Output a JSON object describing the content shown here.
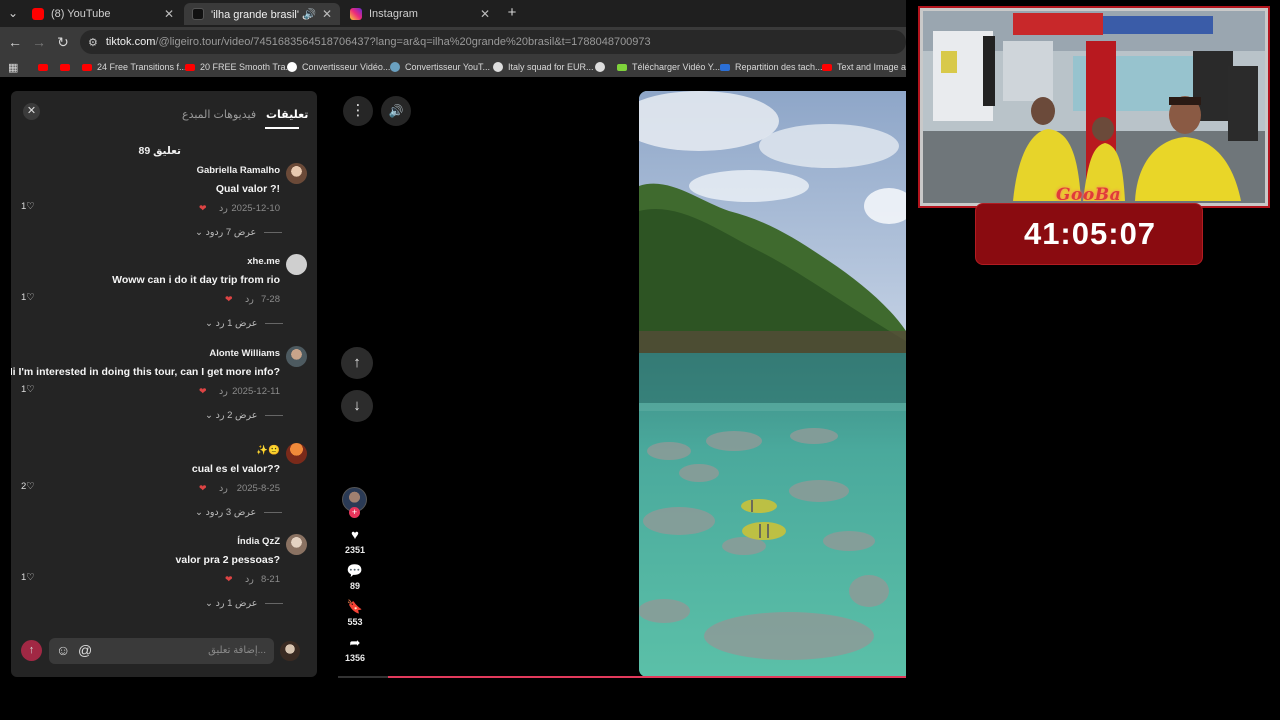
{
  "tabs": [
    {
      "title": "(8) YouTube",
      "color": "#ff0000"
    },
    {
      "title": "'ilha grande brasil' اعثر على",
      "color": "#111111",
      "active": true
    },
    {
      "title": "Instagram",
      "color": "#d62976"
    }
  ],
  "tab_close_glyph": "✕",
  "new_tab_glyph": "+",
  "tab_list_glyph": "⌄",
  "mute_glyph": "🔊",
  "url": {
    "host": "tiktok.com",
    "rest": "/@ligeiro.tour/video/7451683564518706437?lang=ar&q=ilha%20grande%20brasil&t=1788048700973"
  },
  "bookmarks": [
    {
      "label": "",
      "color": "#ff0000"
    },
    {
      "label": "",
      "color": "#ff0000"
    },
    {
      "label": "24 Free Transitions f...",
      "color": "#ff0000"
    },
    {
      "label": "20 FREE Smooth Tra...",
      "color": "#ff0000"
    },
    {
      "label": "Convertisseur Vidéo...",
      "color": "#ffffff",
      "round": true
    },
    {
      "label": "Convertisseur YouT...",
      "color": "#6aa0c0",
      "round": true
    },
    {
      "label": "Italy squad for EUR...",
      "color": "#dddddd",
      "round": true
    },
    {
      "label": "",
      "color": "#dddddd",
      "round": true
    },
    {
      "label": "Télécharger Vidéo Y...",
      "color": "#7fd33b"
    },
    {
      "label": "Repartition des tach...",
      "color": "#2b6fd6"
    },
    {
      "label": "Text and Image ani...",
      "color": "#ff0000"
    }
  ],
  "panel": {
    "tab_comments": "تعليقات",
    "tab_creator_videos": "فيديوهات المبدع",
    "count_label": "89 تعليق",
    "reply_label": "رد",
    "input_placeholder": "إضافة تعليق...",
    "comments": [
      {
        "name": "Gabriella Ramalho",
        "text": "Qual valor ?!",
        "date": "2025-12-10",
        "likes": "1",
        "view": "عرض 7 ردود",
        "avatar": "#b98a70"
      },
      {
        "name": "xhe.me",
        "text": "Woww can i do it day trip from rio",
        "date": "7-28",
        "likes": "1",
        "view": "عرض 1 رد",
        "avatar": "#d0d0d0"
      },
      {
        "name": "Alonte Williams",
        "text": "Hi I'm interested in doing this tour, can I get more info?",
        "date": "2025-12-11",
        "likes": "1",
        "view": "عرض 2 رد",
        "avatar": "#7a8a92"
      },
      {
        "name": "✨🙂",
        "text": "cual es el valor??",
        "date": "2025-8-25",
        "likes": "2",
        "view": "عرض 3 ردود",
        "avatar": "#e05a2a"
      },
      {
        "name": "Índia QzZ",
        "text": "valor pra 2 pessoas?",
        "date": "8-21",
        "likes": "1",
        "view": "عرض 1 رد",
        "avatar": "#c9b6a6"
      }
    ]
  },
  "video_actions": {
    "likes": "2351",
    "comments": "89",
    "saves": "553",
    "shares": "1356"
  },
  "overlay": {
    "brand": "GooBa",
    "timer": "41:05:07"
  }
}
